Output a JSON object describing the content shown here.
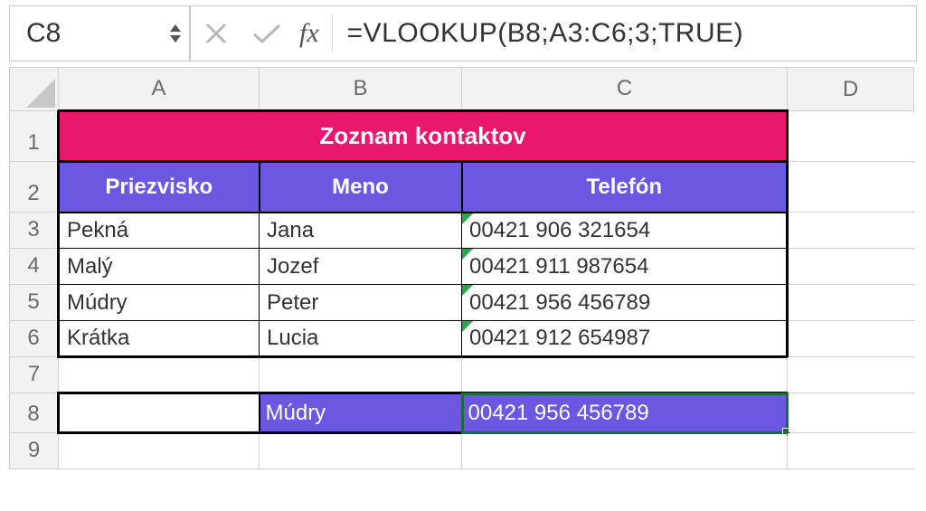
{
  "formula_bar": {
    "name_box": "C8",
    "fx_label": "fx",
    "formula": "=VLOOKUP(B8;A3:C6;3;TRUE)"
  },
  "columns": [
    "A",
    "B",
    "C",
    "D"
  ],
  "rows": [
    "1",
    "2",
    "3",
    "4",
    "5",
    "6",
    "7",
    "8",
    "9"
  ],
  "sheet": {
    "title": "Zoznam kontaktov",
    "headers": {
      "a": "Priezvisko",
      "b": "Meno",
      "c": "Telefón"
    },
    "data": [
      {
        "a": "Pekná",
        "b": "Jana",
        "c": "00421 906 321654"
      },
      {
        "a": "Malý",
        "b": "Jozef",
        "c": "00421 911 987654"
      },
      {
        "a": "Múdry",
        "b": "Peter",
        "c": "00421 956 456789"
      },
      {
        "a": "Krátka",
        "b": "Lucia",
        "c": "00421 912 654987"
      }
    ],
    "lookup": {
      "a": "",
      "b": "Múdry",
      "c": "00421 956 456789"
    }
  }
}
